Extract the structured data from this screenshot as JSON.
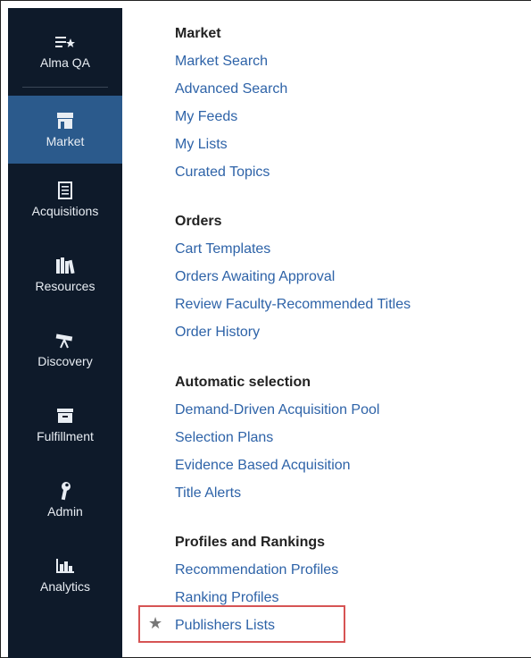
{
  "sidebar": {
    "app_name": "Alma QA",
    "items": [
      {
        "label": "Market",
        "icon": "store-icon",
        "active": true
      },
      {
        "label": "Acquisitions",
        "icon": "ledger-icon"
      },
      {
        "label": "Resources",
        "icon": "books-icon"
      },
      {
        "label": "Discovery",
        "icon": "telescope-icon"
      },
      {
        "label": "Fulfillment",
        "icon": "archive-box-icon"
      },
      {
        "label": "Admin",
        "icon": "wrench-icon"
      },
      {
        "label": "Analytics",
        "icon": "bar-chart-icon"
      }
    ]
  },
  "menu": {
    "sections": [
      {
        "title": "Market",
        "links": [
          "Market Search",
          "Advanced Search",
          "My Feeds",
          "My Lists",
          "Curated Topics"
        ]
      },
      {
        "title": "Orders",
        "links": [
          "Cart Templates",
          "Orders Awaiting Approval",
          "Review Faculty-Recommended Titles",
          "Order History"
        ]
      },
      {
        "title": "Automatic selection",
        "links": [
          "Demand-Driven Acquisition Pool",
          "Selection Plans",
          "Evidence Based Acquisition",
          "Title Alerts"
        ]
      },
      {
        "title": "Profiles and Rankings",
        "links": [
          "Recommendation Profiles",
          "Ranking Profiles",
          "Publishers Lists"
        ]
      }
    ]
  },
  "colors": {
    "sidebar_bg": "#0e1a2a",
    "active_bg": "#2b5a8c",
    "link": "#2e63a8",
    "highlight": "#d65454"
  }
}
